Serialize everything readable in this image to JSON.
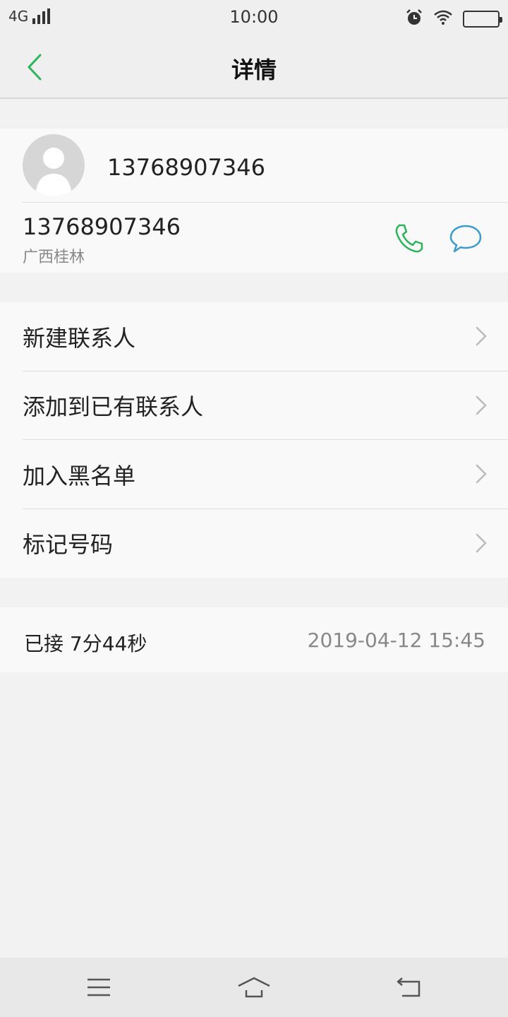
{
  "status_bar": {
    "network": "4G",
    "time": "10:00",
    "icons": [
      "signal-icon",
      "alarm-icon",
      "wifi-icon",
      "battery-icon"
    ]
  },
  "nav": {
    "title": "详情",
    "back_icon": "chevron-left-icon"
  },
  "contact": {
    "name": "13768907346",
    "number": "13768907346",
    "location": "广西桂林",
    "avatar_icon": "person-silhouette-icon",
    "call_icon": "phone-icon",
    "message_icon": "chat-bubble-icon"
  },
  "menu": {
    "items": [
      {
        "label": "新建联系人"
      },
      {
        "label": "添加到已有联系人"
      },
      {
        "label": "加入黑名单"
      },
      {
        "label": "标记号码"
      }
    ]
  },
  "record": {
    "status": "已接 7分44秒",
    "datetime": "2019-04-12 15:45"
  },
  "bottom_nav": {
    "icons": [
      "menu-icon",
      "home-icon",
      "back-icon"
    ]
  },
  "colors": {
    "accent_green": "#2bb55a",
    "message_blue": "#3a9bd5",
    "background": "#f2f2f2",
    "card": "#f9f9f9"
  }
}
